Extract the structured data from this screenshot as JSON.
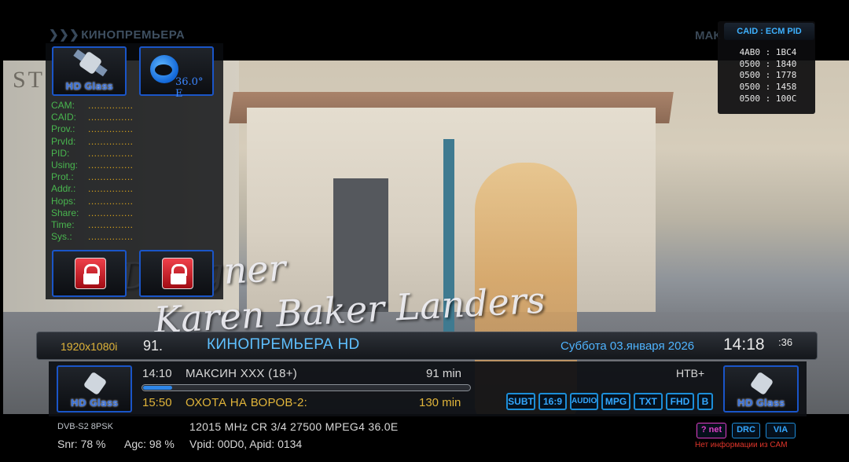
{
  "header": {
    "channel_name": "КИНОПРЕМЬЕРА",
    "right_fragment": "МАК"
  },
  "left_panel": {
    "top_icons": [
      {
        "icon": "satellite-icon",
        "label": "HD Glass"
      },
      {
        "icon": "globe-icon",
        "label": "36.0° E"
      }
    ],
    "cam_fields": [
      {
        "key": "CAM:",
        "value": "..............."
      },
      {
        "key": "CAID:",
        "value": "..............."
      },
      {
        "key": "Prov.:",
        "value": "..............."
      },
      {
        "key": "PrvId:",
        "value": "..............."
      },
      {
        "key": "PID:",
        "value": "..............."
      },
      {
        "key": "Using:",
        "value": "..............."
      },
      {
        "key": "Prot.:",
        "value": "..............."
      },
      {
        "key": "Addr.:",
        "value": "..............."
      },
      {
        "key": "Hops:",
        "value": "..............."
      },
      {
        "key": "Share:",
        "value": "..............."
      },
      {
        "key": "Time:",
        "value": "..............."
      },
      {
        "key": "Sys.:",
        "value": "..............."
      }
    ],
    "lock_icons": [
      "lock-icon",
      "lock-icon"
    ]
  },
  "caid_panel": {
    "title": "CAID : ECM PID",
    "rows": [
      "4AB0 : 1BC4",
      "0500 : 1840",
      "0500 : 1778",
      "0500 : 1458",
      "0500 : 100C"
    ]
  },
  "video_overlay": {
    "sign": "ST",
    "credit_line1": "Designer",
    "credit_line2": "Karen Baker Landers"
  },
  "info_bar": {
    "resolution": "1920x1080i",
    "channel_number": "91.",
    "channel_name": "КИНОПРЕМЬЕРА HD",
    "date": "Суббота  03.января 2026",
    "time": "14:18",
    "seconds": ":36"
  },
  "epg": {
    "current": {
      "time": "14:10",
      "title": "МАКСИН XXX (18+)",
      "duration": "91 min",
      "progress_fraction": 0.09
    },
    "next": {
      "time": "15:50",
      "title": "ОХОТА НА ВОРОВ-2:",
      "duration": "130 min"
    },
    "provider": "НТВ+",
    "channel_logo_label": "HD Glass",
    "badges": [
      "SUBT",
      "16:9",
      "AUDIO",
      "MPG",
      "TXT",
      "FHD",
      "B"
    ]
  },
  "tech": {
    "system": "DVB-S2  8PSK",
    "tuning": "12015 MHz  CR  3/4  27500  MPEG4 36.0E",
    "snr": "Snr: 78 %",
    "agc": "Agc: 98 %",
    "pids": "Vpid: 00D0, Apid: 0134",
    "status_badges": [
      {
        "label": "? net",
        "color": "#e040c8"
      },
      {
        "label": "DRC",
        "color": "#34a7ff"
      },
      {
        "label": "VIA",
        "color": "#34a7ff"
      }
    ],
    "cam_status": "Нет информации из CAM"
  }
}
